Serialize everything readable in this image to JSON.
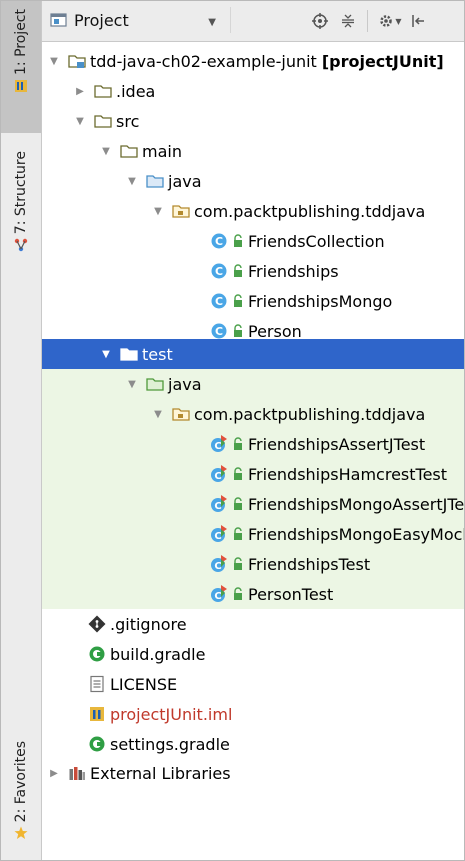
{
  "strip": {
    "project_tab": "1: Project",
    "structure_tab": "7: Structure",
    "favorites_tab": "2: Favorites"
  },
  "header": {
    "view_label": "Project"
  },
  "tree": {
    "root_name": "tdd-java-ch02-example-junit",
    "root_bold": "[projectJUnit]",
    "idea": ".idea",
    "src": "src",
    "main": "main",
    "main_java": "java",
    "main_package": "com.packtpublishing.tddjava",
    "main_classes": [
      "FriendsCollection",
      "Friendships",
      "FriendshipsMongo",
      "Person"
    ],
    "test": "test",
    "test_java": "java",
    "test_package": "com.packtpublishing.tddjava",
    "test_classes": [
      "FriendshipsAssertJTest",
      "FriendshipsHamcrestTest",
      "FriendshipsMongoAssertJTest",
      "FriendshipsMongoEasyMockTest",
      "FriendshipsTest",
      "PersonTest"
    ],
    "gitignore": ".gitignore",
    "build_gradle": "build.gradle",
    "license": "LICENSE",
    "iml": "projectJUnit.iml",
    "settings_gradle": "settings.gradle",
    "external_libraries": "External Libraries"
  },
  "colors": {
    "selection": "#2f65ca",
    "test_background": "#ecf6e4",
    "folder": "#6b6b2e",
    "source_folder": "#4a90c8",
    "iml_text": "#c0392b"
  }
}
